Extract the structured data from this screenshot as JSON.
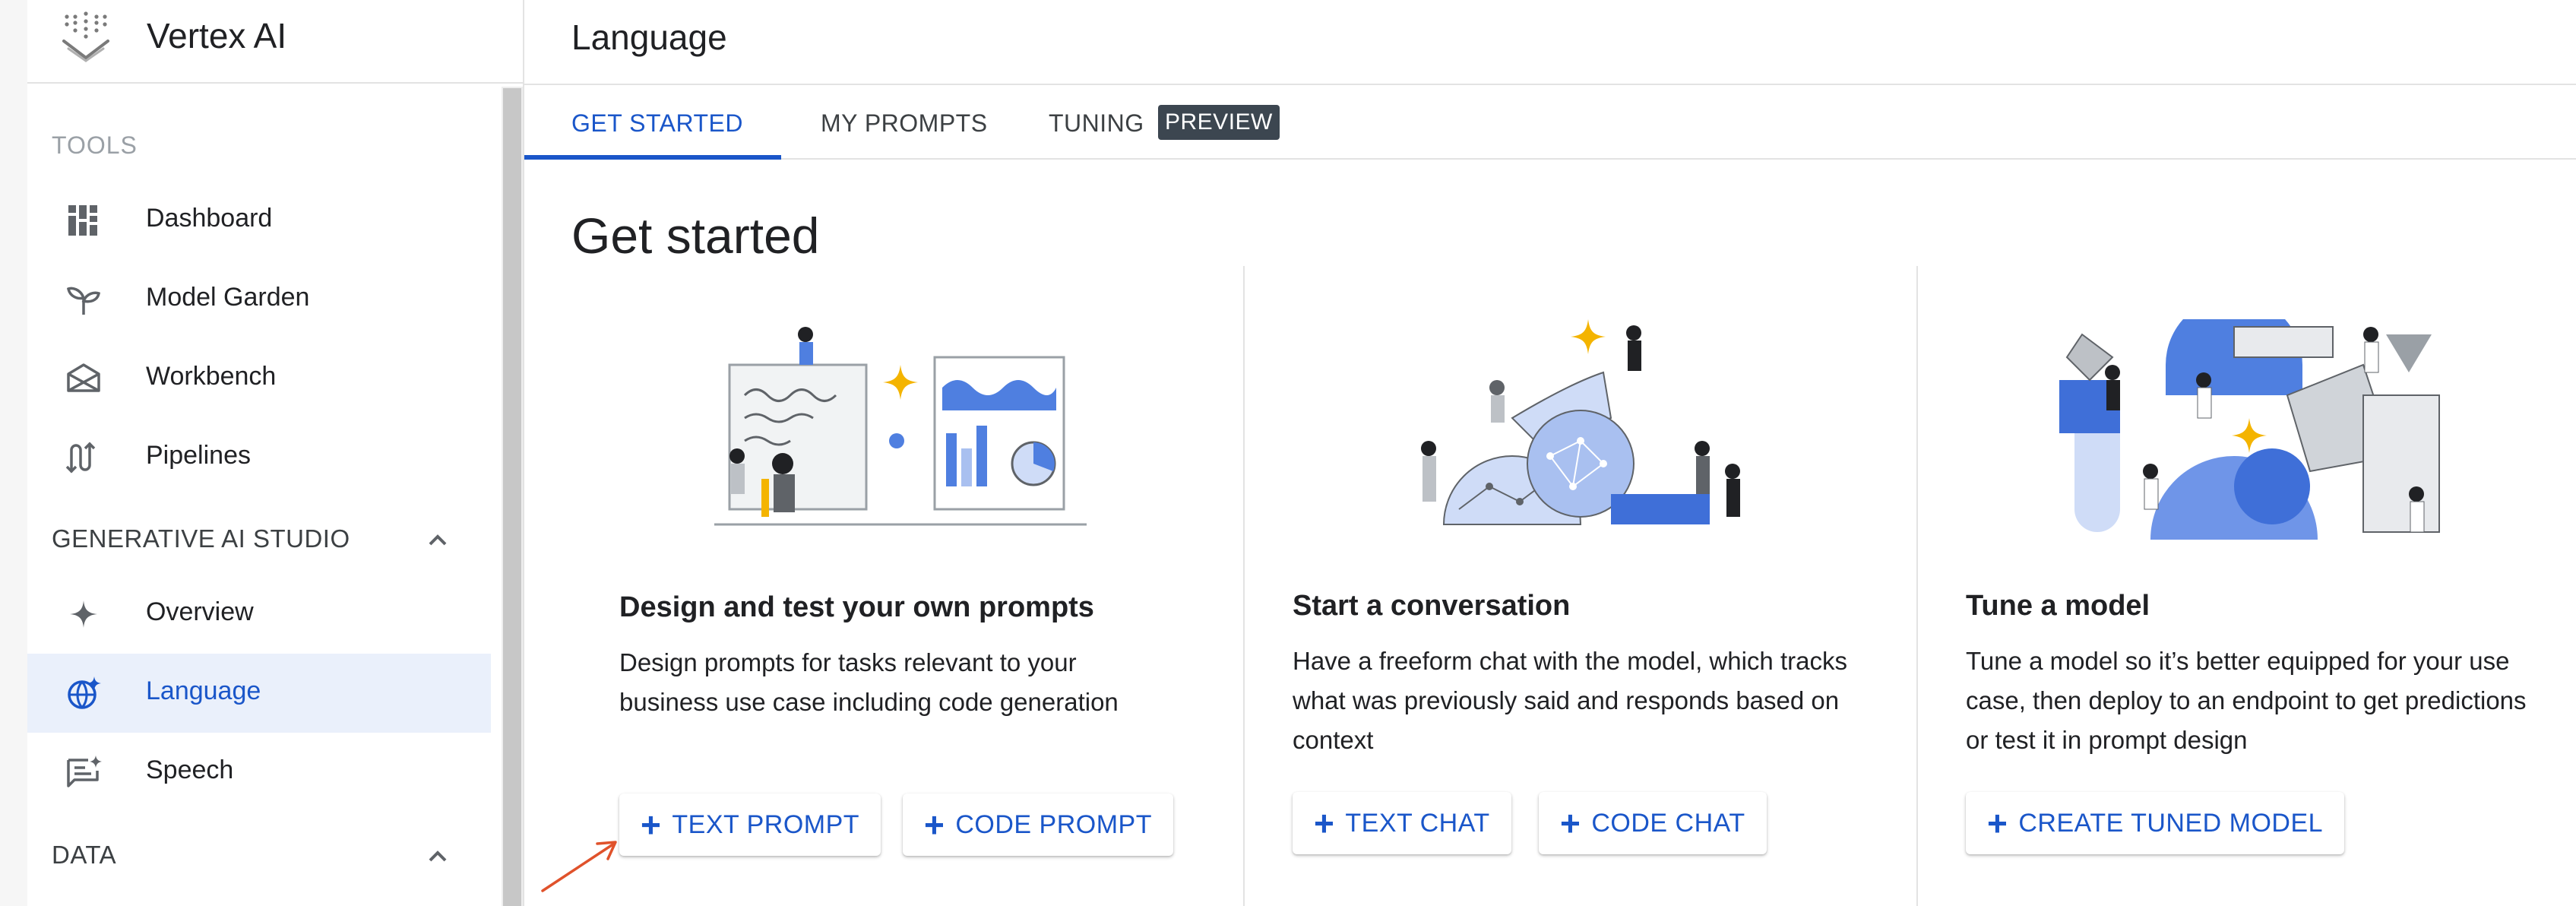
{
  "app": {
    "title": "Vertex AI",
    "logo_icon": "vertex-ai-logo"
  },
  "sidebar": {
    "tools_section": "TOOLS",
    "tools": [
      {
        "label": "Dashboard",
        "icon": "dashboard-icon"
      },
      {
        "label": "Model Garden",
        "icon": "sprout-icon"
      },
      {
        "label": "Workbench",
        "icon": "workbench-icon"
      },
      {
        "label": "Pipelines",
        "icon": "pipelines-icon"
      }
    ],
    "gen_ai_group": "GENERATIVE AI STUDIO",
    "gen_ai_items": [
      {
        "label": "Overview",
        "icon": "sparkle-icon"
      },
      {
        "label": "Language",
        "icon": "language-icon",
        "active": true
      },
      {
        "label": "Speech",
        "icon": "speech-icon"
      }
    ],
    "data_group": "DATA"
  },
  "main": {
    "title": "Language",
    "tabs": [
      {
        "label": "GET STARTED",
        "active": true
      },
      {
        "label": "MY PROMPTS"
      },
      {
        "label": "TUNING",
        "badge": "PREVIEW"
      }
    ],
    "heading": "Get started",
    "cards": [
      {
        "title": "Design and test your own prompts",
        "desc_line1": "Design prompts for tasks relevant to your",
        "desc_line2": "business use case including code generation",
        "desc_line3": "",
        "buttons": [
          "TEXT PROMPT",
          "CODE PROMPT"
        ]
      },
      {
        "title": "Start a conversation",
        "desc_line1": "Have a freeform chat with the model, which tracks",
        "desc_line2": "what was previously said and responds based on",
        "desc_line3": "context",
        "buttons": [
          "TEXT CHAT",
          "CODE CHAT"
        ]
      },
      {
        "title": "Tune a model",
        "desc_line1": "Tune a model so it’s better equipped for your use",
        "desc_line2": "case, then deploy to an endpoint to get predictions",
        "desc_line3": "or test it in prompt design",
        "buttons": [
          "CREATE TUNED MODEL"
        ]
      }
    ]
  },
  "colors": {
    "accent": "#1a56c9",
    "active_bg": "#eaf0fb",
    "badge_bg": "#3c4650",
    "annotation_arrow": "#e0522b"
  }
}
